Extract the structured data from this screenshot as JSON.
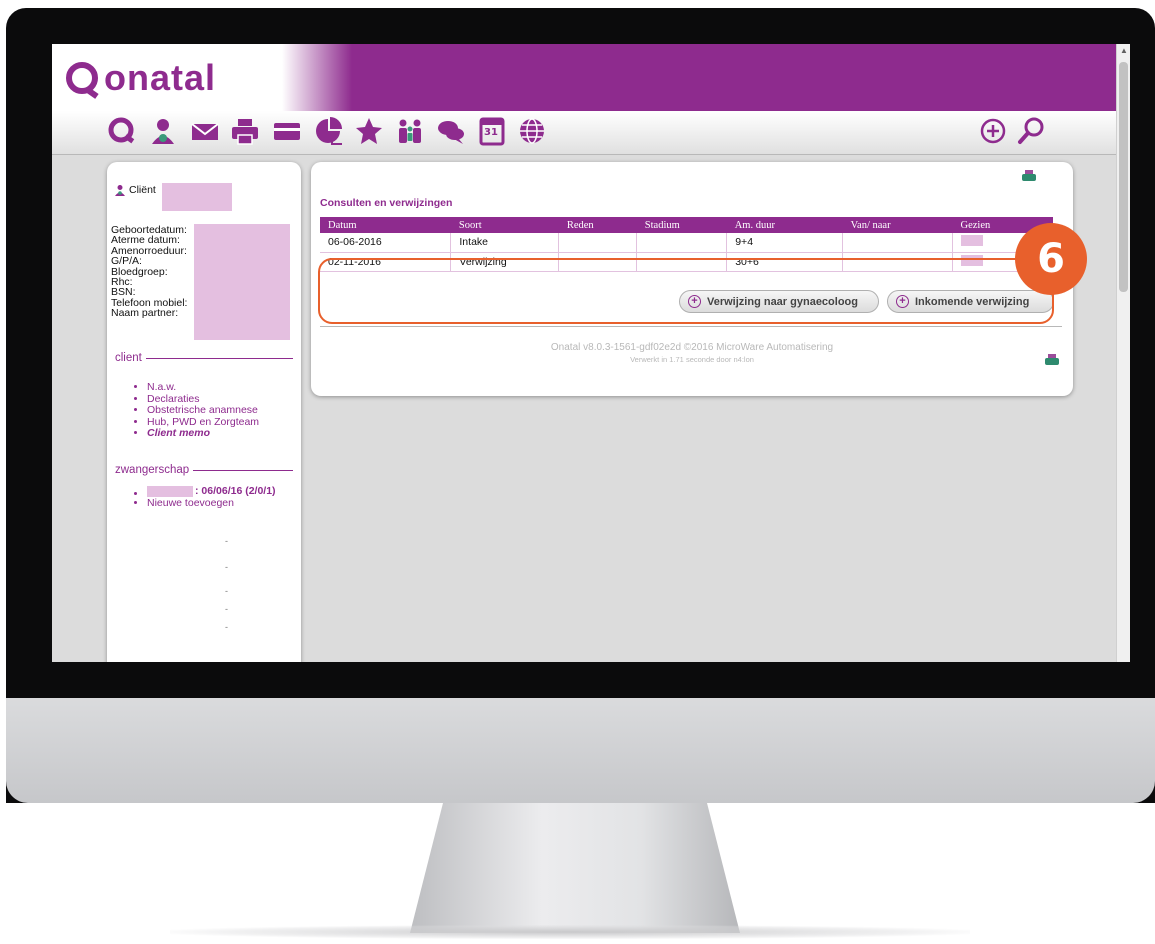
{
  "brand": {
    "name": "onatal",
    "color": "#8e2b8e"
  },
  "toolbar": {
    "icons": [
      "onatal-logo-icon",
      "client-icon",
      "mail-icon",
      "print-icon",
      "card-icon",
      "chart-icon",
      "star-icon",
      "people-icon",
      "chat-icon",
      "calendar-icon",
      "globe-icon"
    ],
    "calendar_day": "31",
    "add_icon": "add-icon",
    "search_icon": "search-icon"
  },
  "sidebar": {
    "client_label": "Cliënt",
    "details": [
      "Geboortedatum:",
      "Aterme datum:",
      "Amenorroeduur:",
      "G/P/A:",
      "Bloedgroep:",
      "Rhc:",
      "BSN:",
      "Telefoon mobiel:",
      "Naam partner:"
    ],
    "client_section": "client",
    "client_links": [
      "N.a.w.",
      "Declaraties",
      "Obstetrische anamnese",
      "Hub, PWD en Zorgteam",
      "Client memo"
    ],
    "pregnancy_section": "zwangerschap",
    "pregnancy_entry": ": 06/06/16 (2/0/1)",
    "pregnancy_add": "Nieuwe toevoegen",
    "dashes": [
      "-",
      "-",
      "-",
      "-",
      "-"
    ]
  },
  "main": {
    "title": "Consulten en verwijzingen",
    "columns": [
      "Datum",
      "Soort",
      "Reden",
      "Stadium",
      "Am. duur",
      "Van/ naar",
      "Gezien"
    ],
    "rows": [
      {
        "datum": "06-06-2016",
        "soort": "Intake",
        "reden": "",
        "stadium": "",
        "am_duur": "9+4",
        "van_naar": ""
      },
      {
        "datum": "02-11-2016",
        "soort": "Verwijzing",
        "reden": "",
        "stadium": "",
        "am_duur": "30+6",
        "van_naar": ""
      }
    ],
    "buttons": {
      "referral_gyn": "Verwijzing naar gynaecoloog",
      "incoming_referral": "Inkomende verwijzing"
    },
    "footer_version": "Onatal v8.0.3-1561-gdf02e2d ©2016 MicroWare Automatisering",
    "footer_processed": "Verwerkt in 1.71 seconde door n4:lon"
  },
  "annotation": {
    "step": "6",
    "color": "#e8602c"
  }
}
